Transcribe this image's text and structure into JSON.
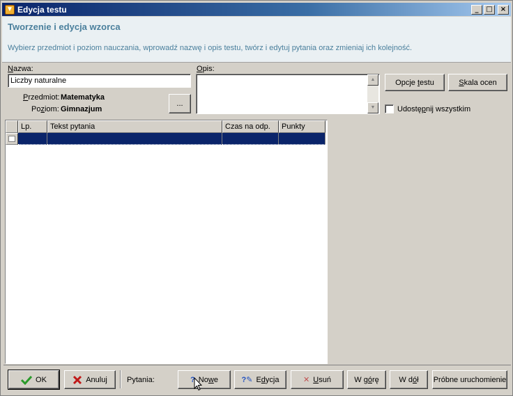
{
  "window": {
    "title": "Edycja testu"
  },
  "header": {
    "title": "Tworzenie i edycja wzorca",
    "description": "Wybierz przedmiot i poziom nauczania, wprowadź nazwę i opis testu, twórz i edytuj pytania oraz zmieniaj ich kolejność."
  },
  "form": {
    "name_label_first": "N",
    "name_label_rest": "azwa:",
    "name_value": "Liczby naturalne",
    "desc_label_first": "O",
    "desc_label_rest": "pis:",
    "desc_value": "",
    "subject_label_first": "P",
    "subject_label_rest": "rzedmiot:",
    "subject_value": "Matematyka",
    "level_label_pre": "Po",
    "level_label_u": "z",
    "level_label_post": "iom:",
    "level_value": "Gimnazjum",
    "browse_label": "...",
    "options_pre": "Opcje ",
    "options_u": "t",
    "options_post": "estu",
    "scale_u": "S",
    "scale_post": "kala ocen",
    "share_pre": "Udostę",
    "share_u": "p",
    "share_post": "nij wszystkim",
    "share_checked": false
  },
  "grid": {
    "columns": [
      "Lp.",
      "Tekst pytania",
      "Czas na odp.",
      "Punkty"
    ]
  },
  "toolbar": {
    "ok_label": "OK",
    "cancel_label": "Anuluj",
    "questions_label": "Pytania:",
    "new_pre": "No",
    "new_u": "w",
    "new_post": "e",
    "edit_pre": "E",
    "edit_u": "d",
    "edit_post": "ycja",
    "delete_u": "U",
    "delete_post": "suń",
    "up_pre": "W g",
    "up_u": "ó",
    "up_post": "rę",
    "down_pre": "W d",
    "down_u": "ó",
    "down_post": "ł",
    "trial_label": "Próbne uruchomienie"
  },
  "colors": {
    "title_bar": "#0a246a",
    "header_text": "#4a7f9c",
    "selection": "#0a246a",
    "ok_icon": "#2a9a2a",
    "cancel_icon": "#c01818"
  }
}
